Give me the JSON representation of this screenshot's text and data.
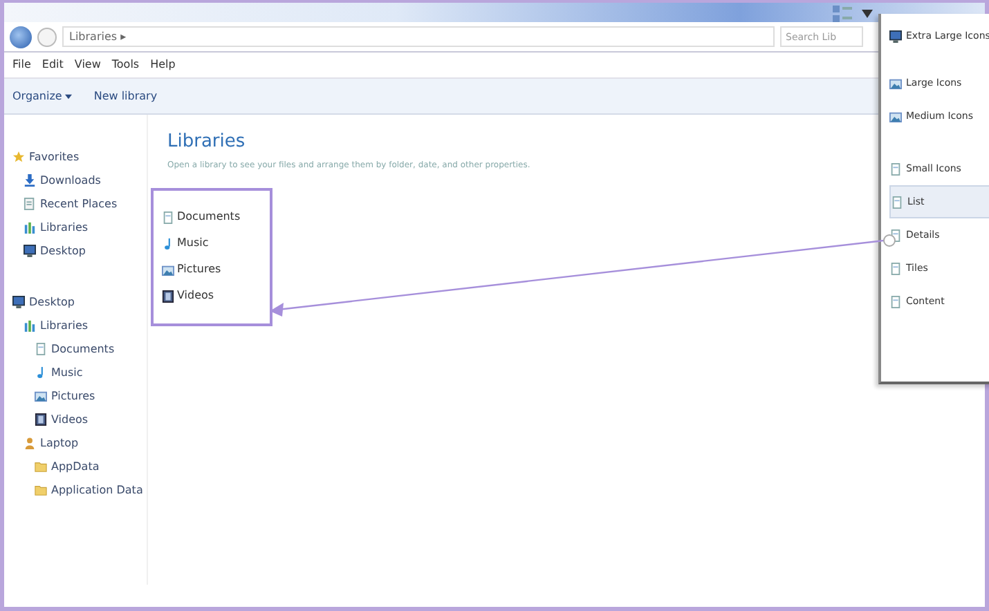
{
  "address_bar": {
    "path": "Libraries ▸",
    "search_placeholder": "Search Lib"
  },
  "menu_bar": [
    "File",
    "Edit",
    "View",
    "Tools",
    "Help"
  ],
  "toolbar": [
    {
      "label": "Organize",
      "dropdown": true
    },
    {
      "label": "New library",
      "dropdown": false
    }
  ],
  "sidebar": [
    {
      "label": "Favorites",
      "kind": "star",
      "children": [
        {
          "label": "Downloads",
          "kind": "download"
        },
        {
          "label": "Recent Places",
          "kind": "places"
        },
        {
          "label": "Libraries",
          "kind": "library"
        },
        {
          "label": "Desktop",
          "kind": "desktop"
        }
      ]
    },
    {
      "label": "Desktop",
      "kind": "desktop",
      "children": [
        {
          "label": "Libraries",
          "kind": "library",
          "children": [
            {
              "label": "Documents",
              "kind": "document"
            },
            {
              "label": "Music",
              "kind": "music"
            },
            {
              "label": "Pictures",
              "kind": "picture"
            },
            {
              "label": "Videos",
              "kind": "video"
            }
          ]
        },
        {
          "label": "Laptop",
          "kind": "user",
          "children": [
            {
              "label": "AppData",
              "kind": "folder"
            },
            {
              "label": "Application Data",
              "kind": "folder"
            }
          ]
        }
      ]
    }
  ],
  "content": {
    "title": "Libraries",
    "description": "Open a library to see your files and arrange them by folder, date, and other properties.",
    "items": [
      {
        "label": "Documents",
        "kind": "document"
      },
      {
        "label": "Music",
        "kind": "music"
      },
      {
        "label": "Pictures",
        "kind": "picture"
      },
      {
        "label": "Videos",
        "kind": "video"
      }
    ]
  },
  "view_menu": [
    {
      "label": "Extra Large Icons",
      "selected": false
    },
    {
      "label": "Large Icons",
      "selected": false
    },
    {
      "label": "Medium Icons",
      "selected": false
    },
    {
      "label": "Small Icons",
      "selected": false
    },
    {
      "label": "List",
      "selected": true
    },
    {
      "label": "Details",
      "selected": false
    },
    {
      "label": "Tiles",
      "selected": false
    },
    {
      "label": "Content",
      "selected": false
    }
  ]
}
